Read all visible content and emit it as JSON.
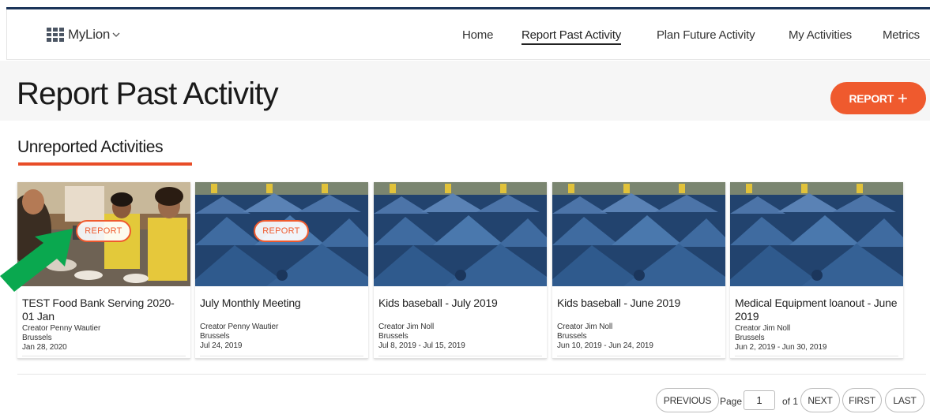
{
  "app": {
    "brand": "MyLion"
  },
  "nav": {
    "items": [
      {
        "label": "Home",
        "active": false
      },
      {
        "label": "Report Past Activity",
        "active": true
      },
      {
        "label": "Plan Future Activity",
        "active": false
      },
      {
        "label": "My Activities",
        "active": false
      },
      {
        "label": "Metrics",
        "active": false
      }
    ]
  },
  "header": {
    "title": "Report Past Activity",
    "report_button": "REPORT",
    "report_button_icon": "plus-icon"
  },
  "section": {
    "title": "Unreported Activities"
  },
  "cards": [
    {
      "title": "TEST Food Bank Serving 2020-01 Jan",
      "creator": "Creator Penny Wautier",
      "location": "Brussels",
      "date": "Jan 28, 2020",
      "image": "food-bank-photo",
      "overlay_button": "REPORT"
    },
    {
      "title": "July Monthly Meeting",
      "creator": "Creator Penny Wautier",
      "location": "Brussels",
      "date": "Jul 24, 2019",
      "image": "blue-tents-photo",
      "overlay_button": "REPORT"
    },
    {
      "title": "Kids baseball - July 2019",
      "creator": "Creator Jim Noll",
      "location": "Brussels",
      "date": "Jul 8, 2019 - Jul 15, 2019",
      "image": "blue-tents-photo"
    },
    {
      "title": "Kids baseball - June 2019",
      "creator": "Creator Jim Noll",
      "location": "Brussels",
      "date": "Jun 10, 2019 - Jun 24, 2019",
      "image": "blue-tents-photo"
    },
    {
      "title": "Medical Equipment loanout - June 2019",
      "creator": "Creator Jim Noll",
      "location": "Brussels",
      "date": "Jun 2, 2019 - Jun 30, 2019",
      "image": "blue-tents-photo"
    }
  ],
  "pagination": {
    "previous": "PREVIOUS",
    "page_label": "Page",
    "page_value": "1",
    "of_label": "of 1",
    "next": "NEXT",
    "first": "FIRST",
    "last": "LAST"
  },
  "colors": {
    "accent": "#ef5a2e",
    "navy": "#1b3459",
    "annotation_arrow": "#0aa84f"
  }
}
